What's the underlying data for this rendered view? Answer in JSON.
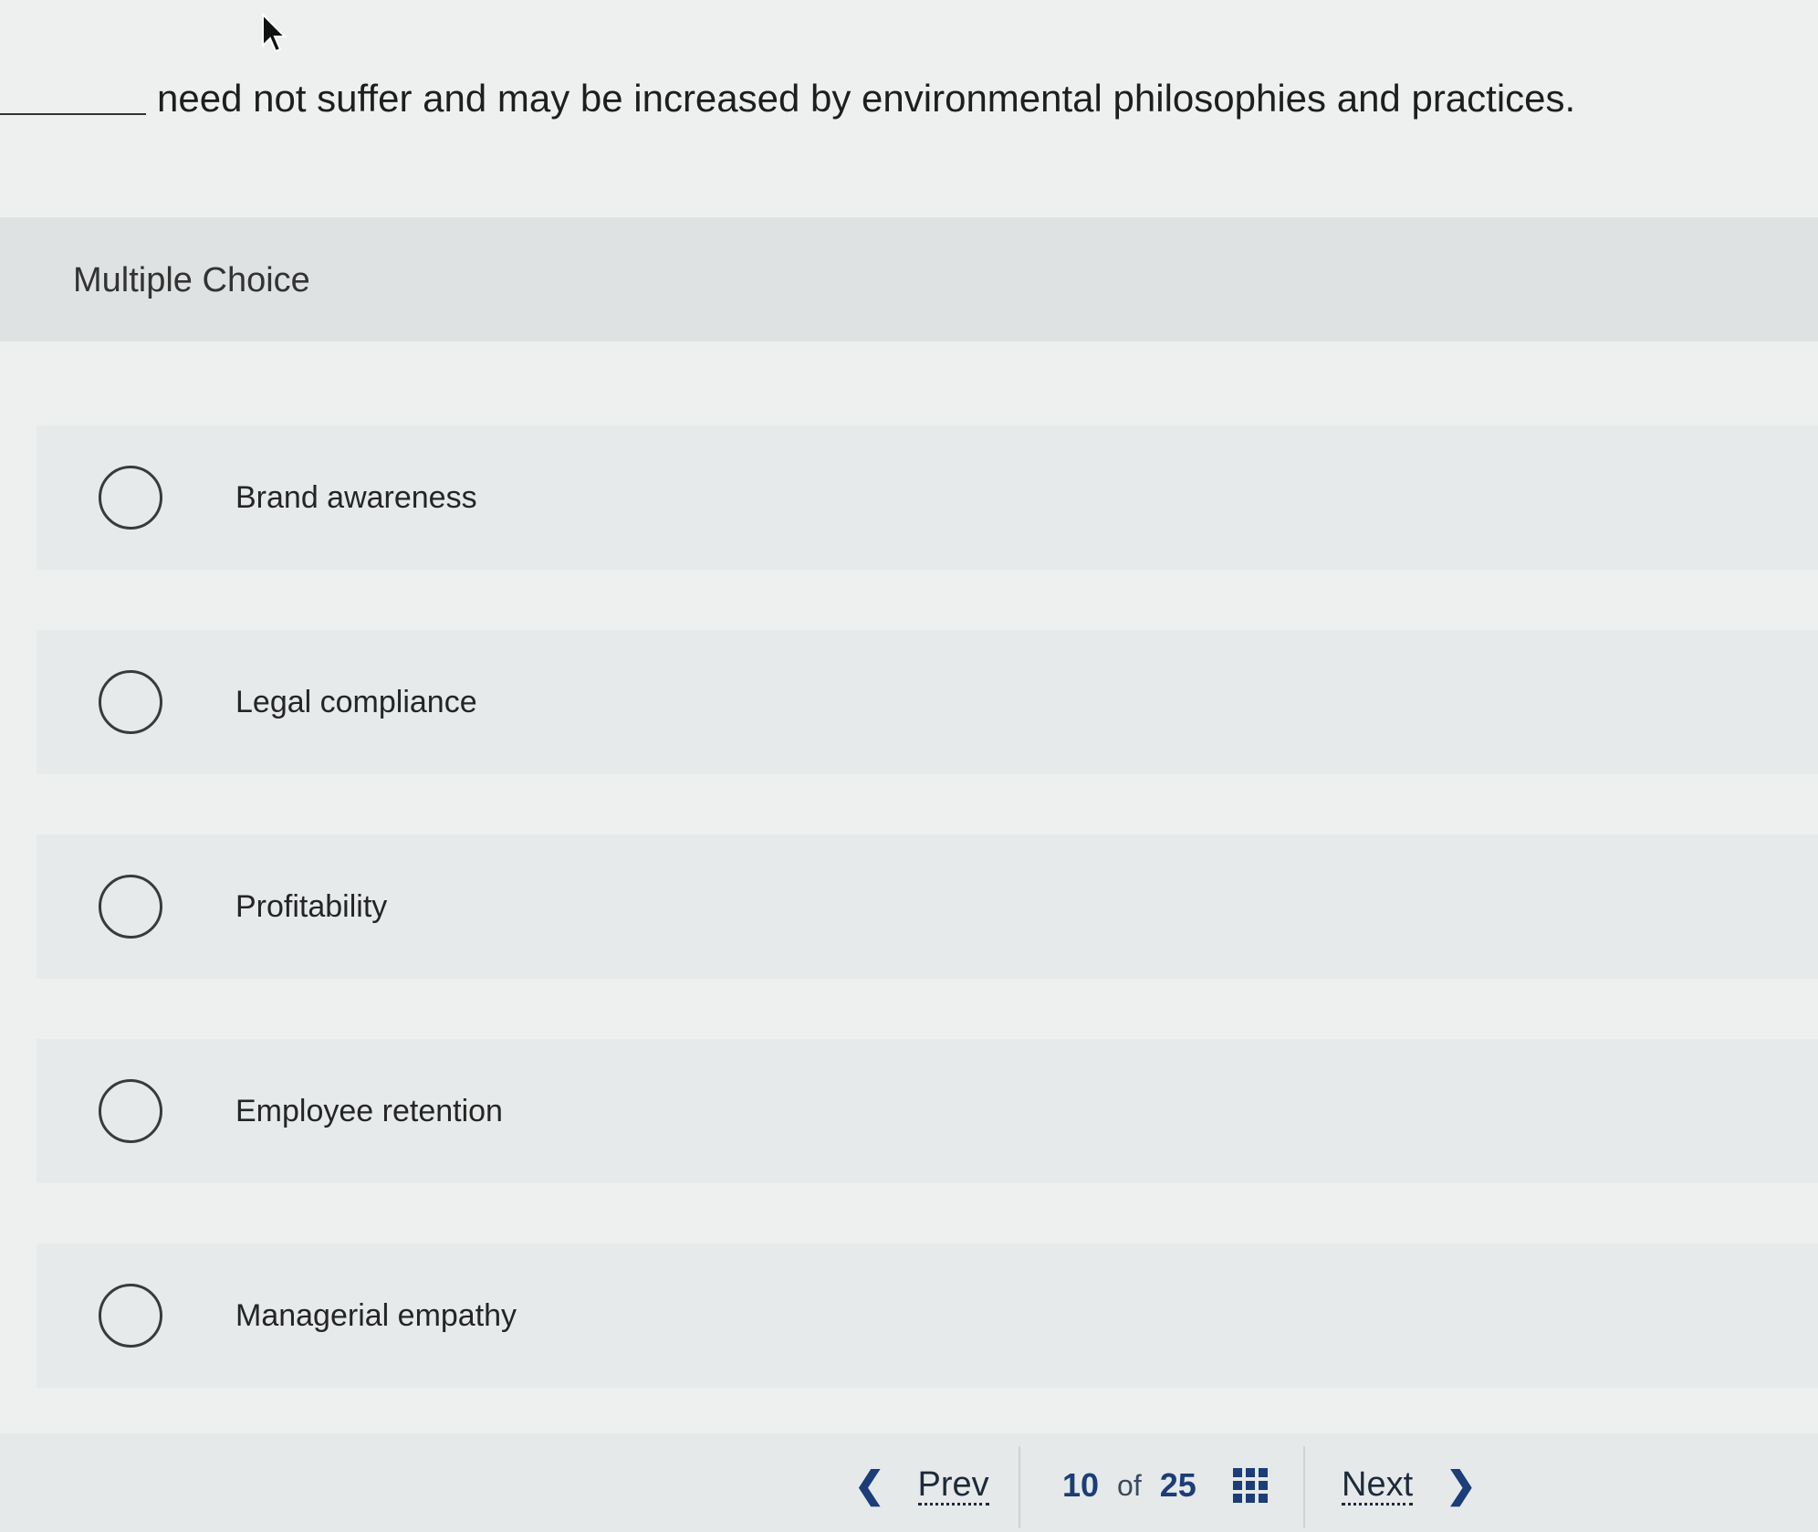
{
  "question": {
    "text": "need not suffer and may be increased by environmental philosophies and practices."
  },
  "header": {
    "title": "Multiple Choice"
  },
  "options": [
    {
      "label": "Brand awareness"
    },
    {
      "label": "Legal compliance"
    },
    {
      "label": "Profitability"
    },
    {
      "label": "Employee retention"
    },
    {
      "label": "Managerial empathy"
    }
  ],
  "navigation": {
    "prev_label": "Prev",
    "next_label": "Next",
    "current_page": "10",
    "of_label": "of",
    "total_pages": "25"
  },
  "icons": {
    "prev": "chevron-left-icon",
    "next": "chevron-right-icon",
    "grid": "grid-icon",
    "cursor": "mouse-pointer-icon"
  }
}
